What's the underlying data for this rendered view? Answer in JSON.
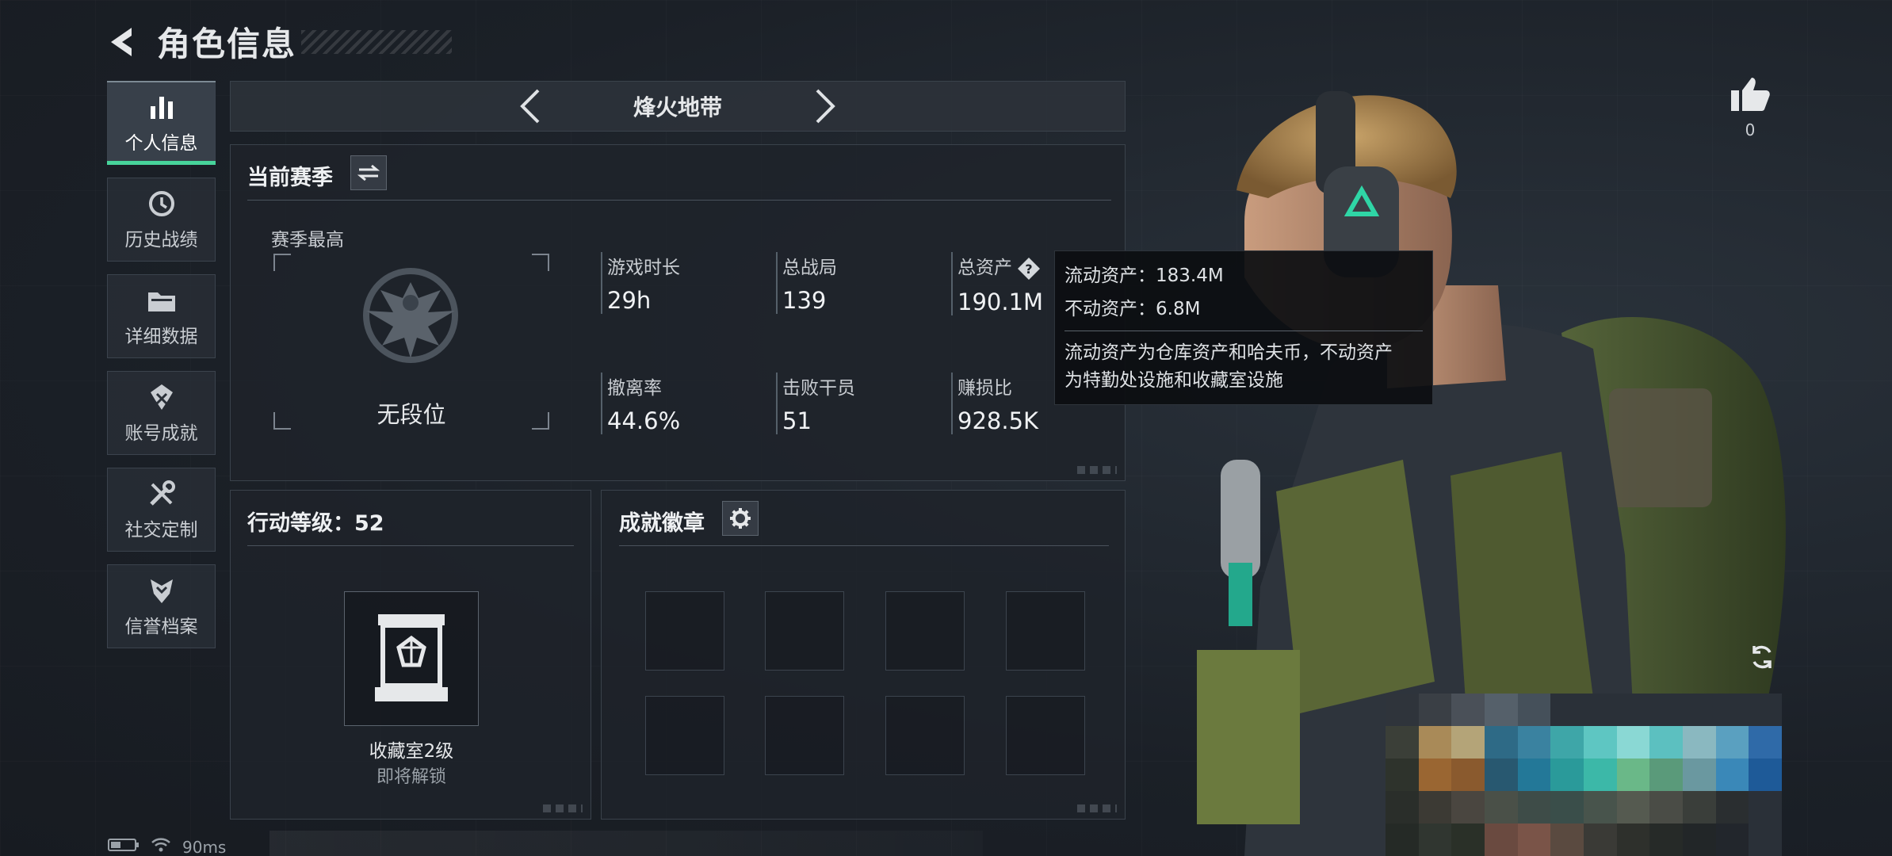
{
  "header": {
    "title": "角色信息"
  },
  "sidebar": {
    "items": [
      {
        "label": "个人信息",
        "icon": "bar-chart-icon",
        "active": true
      },
      {
        "label": "历史战绩",
        "icon": "history-clock-icon"
      },
      {
        "label": "详细数据",
        "icon": "folder-icon"
      },
      {
        "label": "账号成就",
        "icon": "achievement-icon"
      },
      {
        "label": "社交定制",
        "icon": "tools-icon"
      },
      {
        "label": "信誉档案",
        "icon": "shield-chevron-icon"
      }
    ]
  },
  "map_selector": {
    "name": "烽火地带"
  },
  "season_panel": {
    "title": "当前赛季",
    "rank_label": "赛季最高",
    "rank_name": "无段位",
    "stats": {
      "playtime": {
        "label": "游戏时长",
        "value": "29h"
      },
      "matches": {
        "label": "总战局",
        "value": "139"
      },
      "assets": {
        "label": "总资产",
        "value": "190.1M"
      },
      "extract_rate": {
        "label": "撤离率",
        "value": "44.6%"
      },
      "kills": {
        "label": "击败干员",
        "value": "51"
      },
      "profit_ratio": {
        "label": "赚损比",
        "value": "928.5K"
      }
    }
  },
  "tooltip": {
    "liquid": "流动资产：183.4M",
    "fixed": "不动资产：6.8M",
    "desc_line1": "流动资产为仓库资产和哈夫币，不动资产",
    "desc_line2": "为特勤处设施和收藏室设施"
  },
  "level_panel": {
    "title": "行动等级：52",
    "vault_name": "收藏室2级",
    "vault_status": "即将解锁"
  },
  "badge_panel": {
    "title": "成就徽章",
    "slots": 8
  },
  "likes": {
    "count": "0"
  },
  "status_bar": {
    "ping": "90ms"
  },
  "colors": {
    "accent": "#47d49b",
    "panel": "#1e232a",
    "background": "#1c2128"
  }
}
